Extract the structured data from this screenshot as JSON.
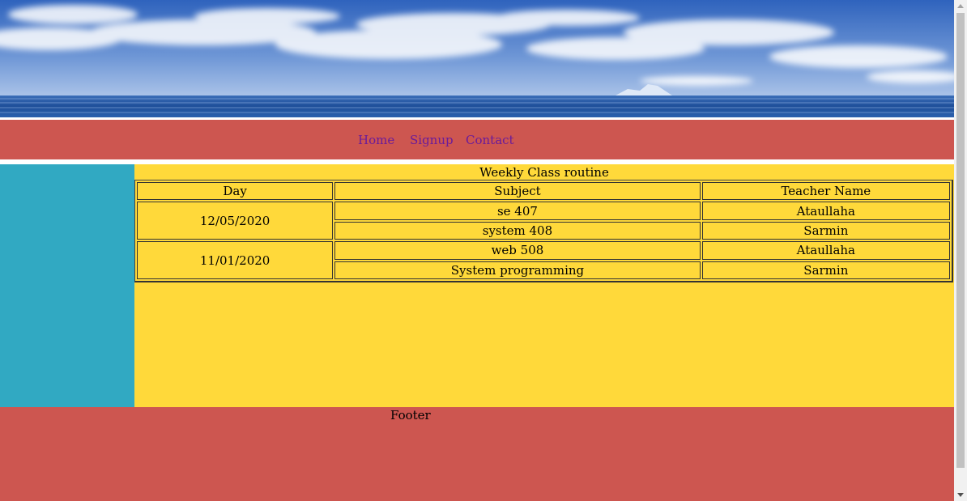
{
  "nav": {
    "items": [
      {
        "label": "Home"
      },
      {
        "label": "Signup"
      },
      {
        "label": "Contact"
      }
    ]
  },
  "main": {
    "caption": "Weekly Class routine",
    "headers": [
      "Day",
      "Subject",
      "Teacher Name"
    ],
    "groups": [
      {
        "day": "12/05/2020",
        "rows": [
          {
            "subject": "se 407",
            "teacher": "Ataullaha"
          },
          {
            "subject": "system 408",
            "teacher": "Sarmin"
          }
        ]
      },
      {
        "day": "11/01/2020",
        "rows": [
          {
            "subject": "web 508",
            "teacher": "Ataullaha"
          },
          {
            "subject": "System programming",
            "teacher": "Sarmin"
          }
        ]
      }
    ]
  },
  "footer": {
    "text": "Footer"
  },
  "colors": {
    "nav_bg": "#cd5650",
    "sidebar_bg": "#31a9c2",
    "main_bg": "#ffd93a",
    "link": "#6a1b9a"
  }
}
